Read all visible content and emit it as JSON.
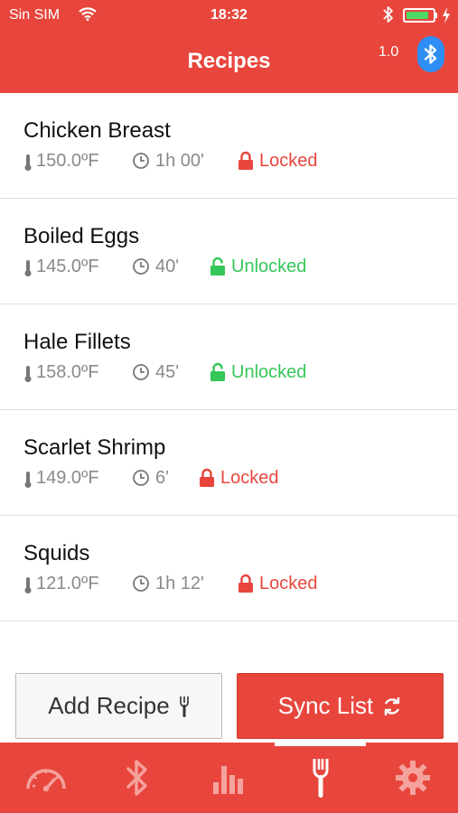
{
  "status_bar": {
    "carrier": "Sin SIM",
    "time": "18:32",
    "battery_level": 0.85
  },
  "nav": {
    "title": "Recipes",
    "version": "1.0"
  },
  "recipes": [
    {
      "name": "Chicken Breast",
      "temp": "150.0ºF",
      "duration": "1h 00'",
      "status": "Locked"
    },
    {
      "name": "Boiled Eggs",
      "temp": "145.0ºF",
      "duration": "40'",
      "status": "Unlocked"
    },
    {
      "name": "Hale Fillets",
      "temp": "158.0ºF",
      "duration": "45'",
      "status": "Unlocked"
    },
    {
      "name": "Scarlet Shrimp",
      "temp": "149.0ºF",
      "duration": "6'",
      "status": "Locked"
    },
    {
      "name": "Squids",
      "temp": "121.0ºF",
      "duration": "1h 12'",
      "status": "Locked"
    }
  ],
  "buttons": {
    "add_recipe": "Add Recipe",
    "sync_list": "Sync List"
  },
  "tabs": [
    {
      "icon": "speedometer-icon"
    },
    {
      "icon": "bluetooth-icon"
    },
    {
      "icon": "bar-chart-icon"
    },
    {
      "icon": "fork-icon",
      "selected": true
    },
    {
      "icon": "gear-icon"
    }
  ],
  "colors": {
    "brand_red": "#e8463d",
    "locked": "#e8463d",
    "unlocked": "#35c759",
    "bluetooth_badge": "#2f8ef3"
  }
}
